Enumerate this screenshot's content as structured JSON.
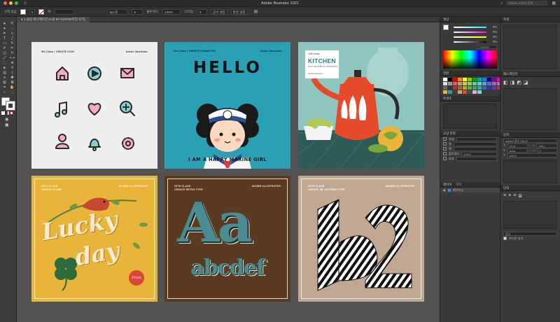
{
  "window": {
    "title": "Adobe Illustrator 2021",
    "search_placeholder": "Adobe Stock 검색"
  },
  "controlbar": {
    "selection_label": "선택 없음",
    "stroke_label": "획:",
    "stroke_weight": "5pt 원",
    "opacity_label": "불투명도:",
    "opacity_value": "100%",
    "style_label": "스타일:",
    "doc_setup": "문서 설정",
    "prefs": "환경 설정"
  },
  "document_tab": {
    "label": "● 1 클립 애니메이션.ai @ 50 %(RGB/미리 보기)"
  },
  "artboards": {
    "a1": {
      "left": "9th Class  /  CREATE ICON",
      "right": "Adobe Illustrator"
    },
    "a2": {
      "left": "10th Class  /  CREATE ANIMATION",
      "right": "Adobe Illustrator",
      "headline": "HELLO",
      "caption": "I AM A HAPPY MARINE GIRL"
    },
    "a3": {
      "badge_small": "10th Class",
      "badge_title": "KITCHEN",
      "badge_sub": "FLAT VECTOR ILLUSTRATION",
      "badge_foot": "Adobe Illustrator"
    },
    "a4": {
      "left1": "19TH CLASS",
      "left2": "CREATE STAMP",
      "right": "ADOBE ILLUSTRATOR",
      "word1": "Lucky",
      "word2": "day",
      "stamp": "From"
    },
    "a5": {
      "left1": "23TH CLASS",
      "left2": "CREATE RETRO TYPE",
      "right": "ADOBE ILLUSTRATOR",
      "big": "Aa",
      "row": "abcdef"
    },
    "a6": {
      "left1": "24TH CLASS",
      "left2": "CREATE 3D, PATTERN TYPE",
      "right": "ADOBE ILLUSTRATOR"
    }
  },
  "color_panel": {
    "title": "색상",
    "c": "0%",
    "m": "0%",
    "y": "0%",
    "k": "0%",
    "hex": "FFFFFF"
  },
  "swatches_panel": {
    "title": "견본"
  },
  "align_panel": {
    "title": "투명도"
  },
  "appearance_panel": {
    "title": "모양 관리",
    "items": [
      "속성",
      "칠",
      "획",
      "불투명도",
      "효과"
    ],
    "values": [
      "",
      "",
      "",
      "100%",
      ""
    ]
  },
  "layers_panel": {
    "title": "레이어",
    "tab2": "대지",
    "layer": "레이어 1"
  },
  "properties_panel": {
    "title": "속성",
    "sub": "패스파인더",
    "char_title": "문자",
    "font": "Adobe 명조 Std M",
    "size": "12 pt",
    "leading": "Auto",
    "tracking": "0",
    "kerning": "Auto",
    "percent": "100%",
    "para_title": "단락",
    "opt": "명사",
    "check": "하이픈 넣기"
  },
  "colors": {
    "accent": "#2aa0b5"
  }
}
